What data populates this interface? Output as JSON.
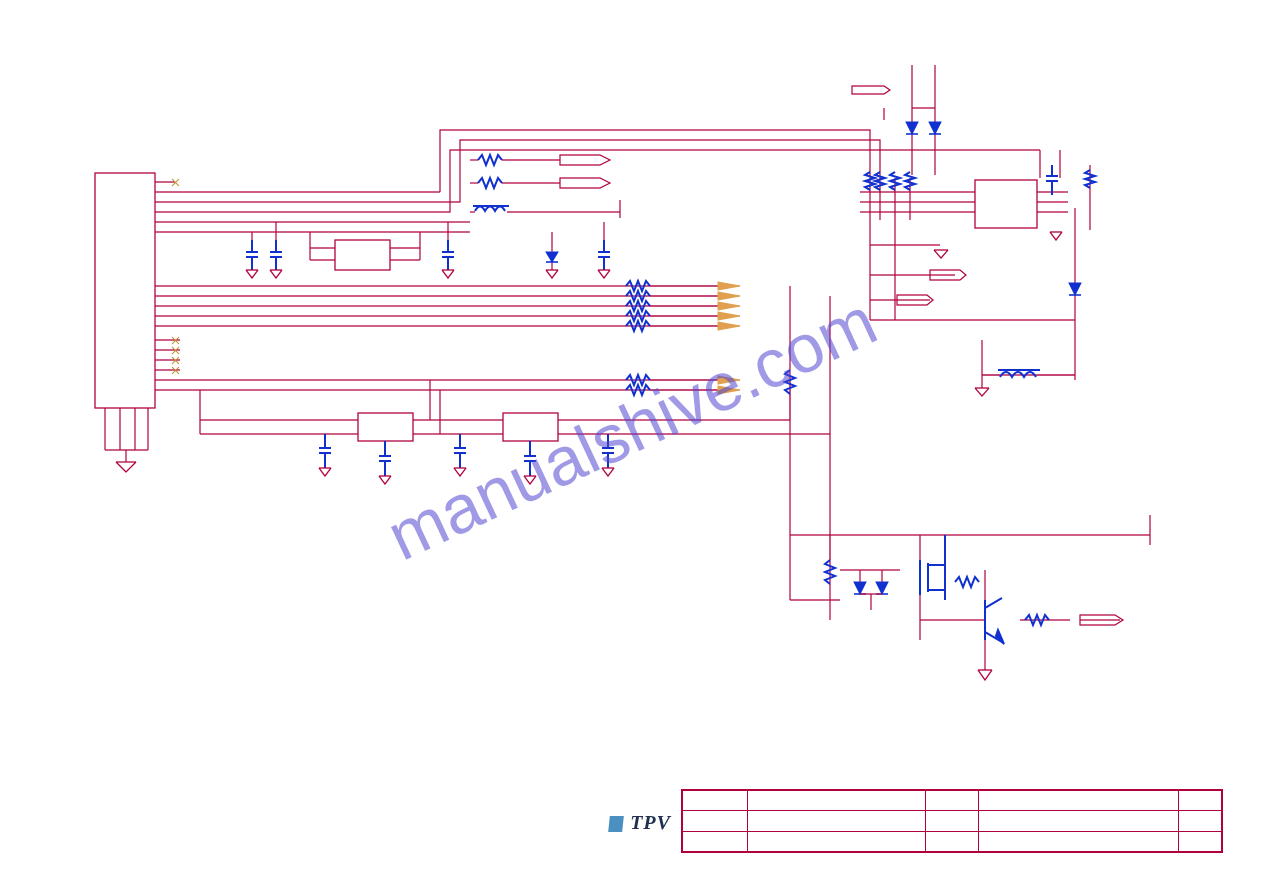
{
  "watermark": "manualshive.com",
  "logo": {
    "text": "TPV"
  },
  "title_block": {
    "row1": {
      "c1": "",
      "c2": "",
      "c3": "",
      "c4": "",
      "c5": ""
    },
    "row2": {
      "c1": "",
      "c2": "",
      "c3": "",
      "c4": "",
      "c5": ""
    },
    "row3": {
      "c1": "",
      "c2": "",
      "c3": "",
      "c4": "",
      "c5": ""
    }
  },
  "net_flags": [
    "",
    "",
    "",
    "",
    "",
    "",
    "",
    "",
    "",
    ""
  ],
  "connector": {
    "pins": 22
  },
  "blocks": {
    "u1": "",
    "u2": "",
    "u3": "",
    "u4": ""
  }
}
